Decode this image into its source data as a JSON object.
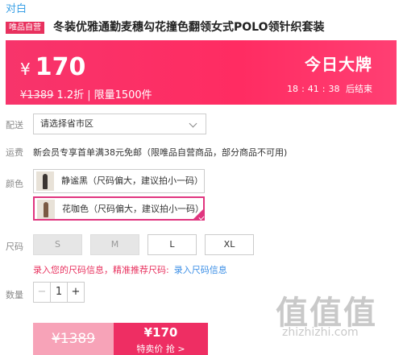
{
  "header": {
    "brand": "对白",
    "badge": "唯品自营",
    "title": "冬装优雅通勤麦穗勾花撞色翻领女式POLO领针织套装"
  },
  "price_banner": {
    "currency": "¥",
    "price": "170",
    "original_price": "¥1389",
    "discount": "1.2折",
    "divider": "|",
    "limit": "限量1500件",
    "promo_title": "今日大牌",
    "countdown": {
      "h": "18",
      "m": "41",
      "s": "38",
      "colon": ":",
      "suffix": "后结束"
    }
  },
  "delivery": {
    "label": "配送",
    "placeholder": "请选择省市区"
  },
  "shipping": {
    "label": "运费",
    "text": "新会员专享首单满38元免邮（限唯品自营商品，部分商品不可用)"
  },
  "colors": {
    "label": "颜色",
    "options": [
      {
        "name": "静谧黑（尺码偏大，建议拍小一码）",
        "swatch": "#3b3532",
        "selected": false
      },
      {
        "name": "花咖色（尺码偏大，建议拍小一码）",
        "swatch": "#7a5a44",
        "selected": true
      }
    ]
  },
  "sizes": {
    "label": "尺码",
    "options": [
      {
        "name": "S",
        "disabled": true
      },
      {
        "name": "M",
        "disabled": true
      },
      {
        "name": "L",
        "disabled": false
      },
      {
        "name": "XL",
        "disabled": false
      }
    ]
  },
  "size_hint": {
    "text": "录入您的尺码信息，精准推荐尺码:",
    "link": "录入尺码信息"
  },
  "quantity": {
    "label": "数量",
    "value": "1",
    "minus": "−",
    "plus": "+"
  },
  "buy": {
    "original": "¥1389",
    "price": "¥170",
    "action": "特卖价 抢 >"
  },
  "watermark": {
    "logo": "值值值",
    "url": "zhizhizhi.com"
  },
  "colors_theme": {
    "accent": "#ee2e63",
    "link": "#3a8ee6",
    "brand": "#3aa0e6"
  }
}
